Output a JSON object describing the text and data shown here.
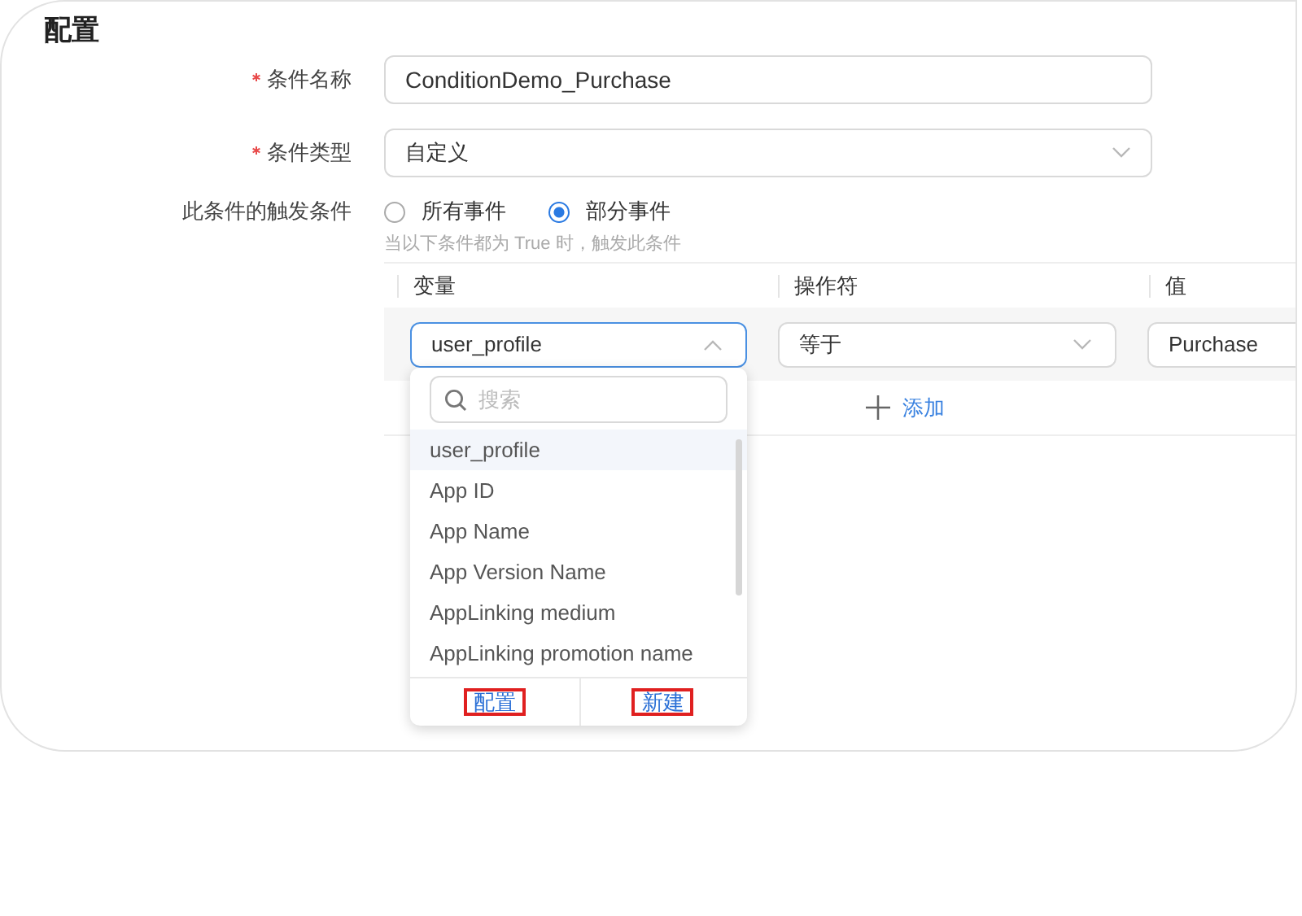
{
  "title": "配置",
  "fields": [
    {
      "kind": "text",
      "label": "条件名称",
      "required": true,
      "value": "ConditionDemo_Purchase"
    },
    {
      "kind": "select",
      "label": "条件类型",
      "required": true,
      "value": "自定义"
    }
  ],
  "trigger": {
    "label": "此条件的触发条件",
    "options": [
      {
        "label": "所有事件",
        "selected": false
      },
      {
        "label": "部分事件",
        "selected": true
      }
    ],
    "hint": "当以下条件都为 True 时，触发此条件"
  },
  "conditions": {
    "columns": [
      "变量",
      "操作符",
      "值"
    ],
    "rows": [
      {
        "variable": "user_profile",
        "expanded": true,
        "operator": "等于",
        "value": "Purchase"
      }
    ],
    "add_label": "添加"
  },
  "dropdown": {
    "placeholder": "搜索",
    "items": [
      {
        "label": "user_profile",
        "selected": true
      },
      {
        "label": "App ID",
        "selected": false
      },
      {
        "label": "App Name",
        "selected": false
      },
      {
        "label": "App Version Name",
        "selected": false
      },
      {
        "label": "AppLinking medium",
        "selected": false
      },
      {
        "label": "AppLinking promotion name",
        "selected": false
      }
    ],
    "footer_buttons": [
      "配置",
      "新建"
    ]
  }
}
